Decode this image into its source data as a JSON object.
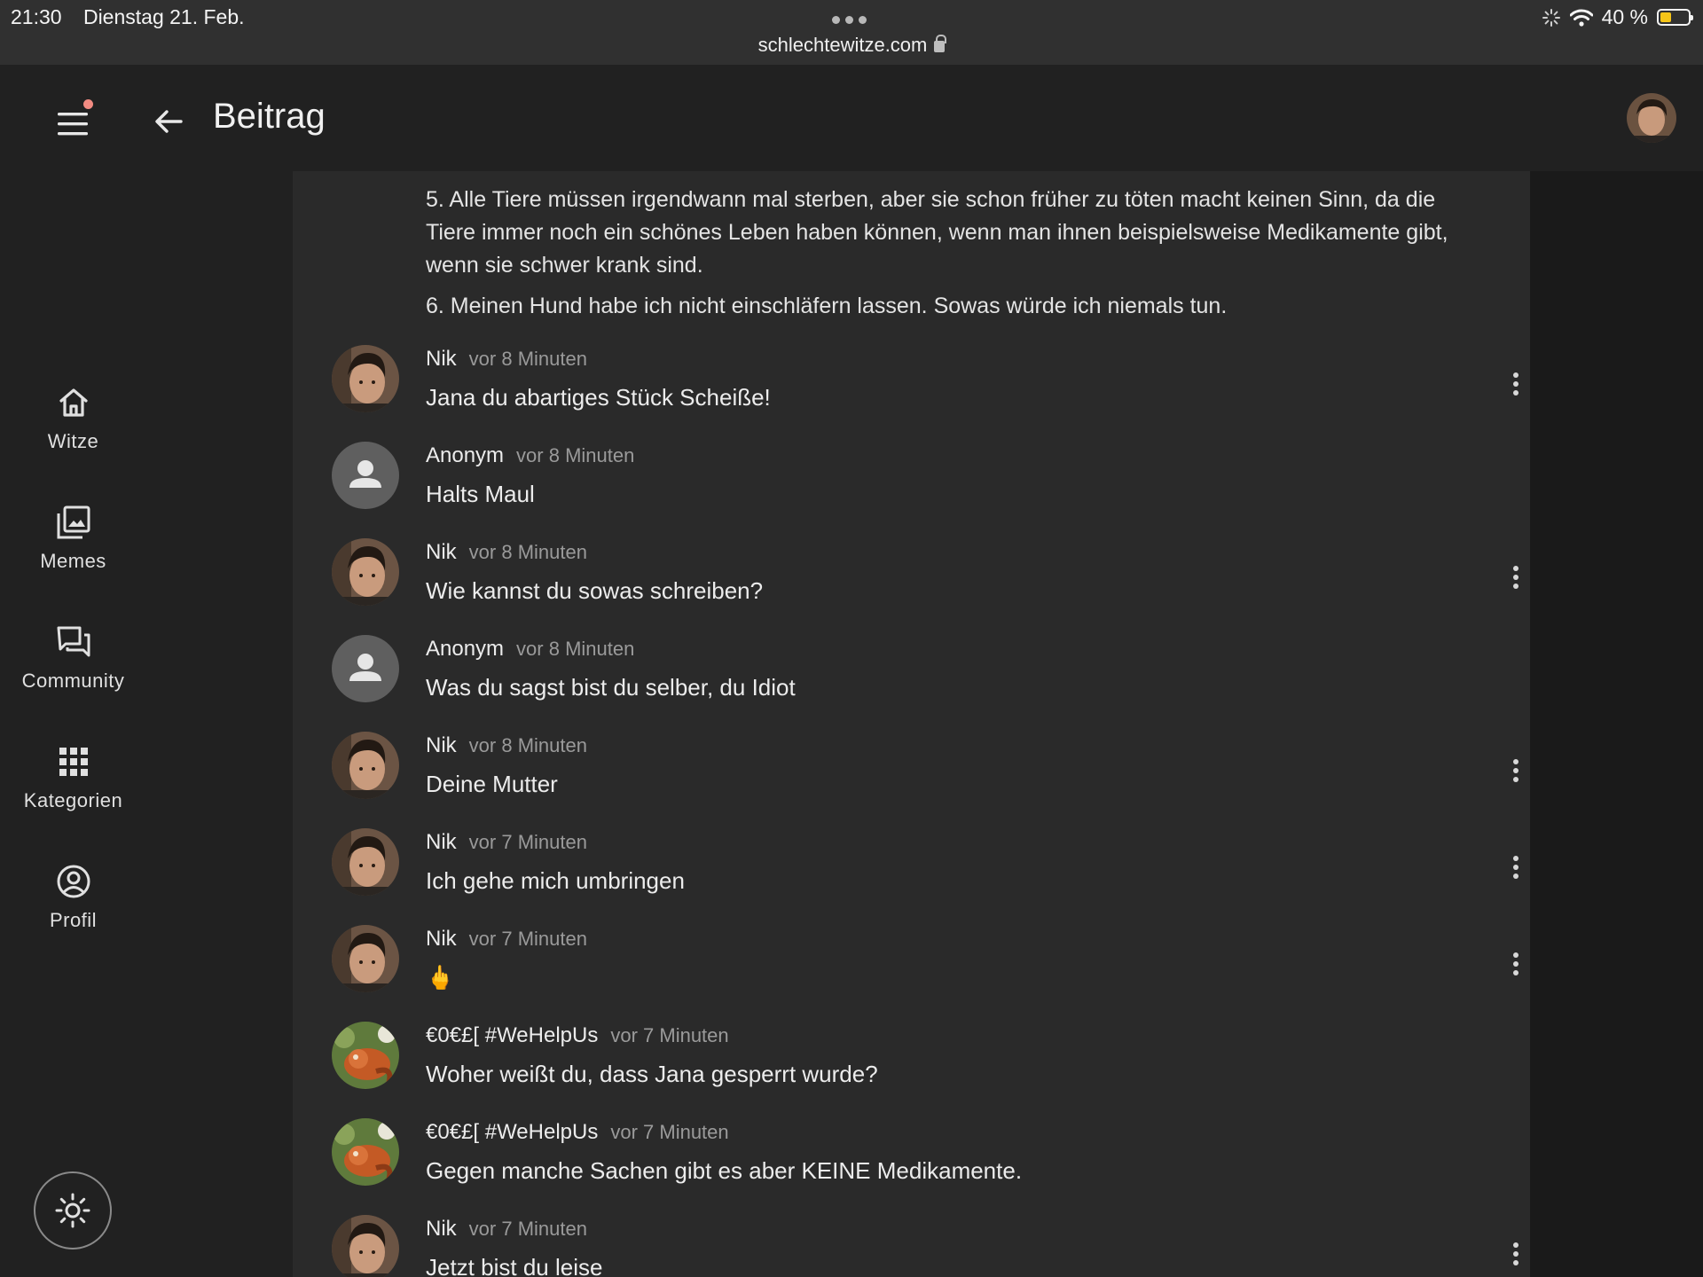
{
  "status": {
    "time": "21:30",
    "date": "Dienstag 21. Feb.",
    "url": "schlechtewitze.com",
    "battery_text": "40 %",
    "battery_level": 0.4,
    "battery_color": "#f5c518"
  },
  "header": {
    "title": "Beitrag",
    "menu_icon": "hamburger-menu-icon",
    "back_icon": "arrow-left-icon",
    "notification_dot_color": "#f28b82"
  },
  "sidebar": {
    "items": [
      {
        "label": "Witze",
        "icon": "home-icon"
      },
      {
        "label": "Memes",
        "icon": "photo-library-icon"
      },
      {
        "label": "Community",
        "icon": "forum-icon"
      },
      {
        "label": "Kategorien",
        "icon": "apps-grid-icon"
      },
      {
        "label": "Profil",
        "icon": "account-circle-icon"
      }
    ],
    "theme_icon": "sun-icon"
  },
  "post": {
    "points": [
      "5. Alle Tiere müssen irgendwann mal sterben, aber sie schon früher zu töten macht keinen Sinn, da die Tiere immer noch ein schönes Leben haben können, wenn man ihnen beispielsweise Medikamente gibt, wenn sie schwer krank sind.",
      "6. Meinen Hund habe ich nicht einschläfern lassen. Sowas würde ich niemals tun."
    ]
  },
  "comments": [
    {
      "author": "Nik",
      "time": "vor 8 Minuten",
      "text": "Jana du abartiges Stück Scheiße!"
    },
    {
      "author": "Anonym",
      "time": "vor 8 Minuten",
      "text": "Halts Maul"
    },
    {
      "author": "Nik",
      "time": "vor 8 Minuten",
      "text": "Wie kannst du sowas schreiben?"
    },
    {
      "author": "Anonym",
      "time": "vor 8 Minuten",
      "text": "Was du sagst bist du selber, du Idiot"
    },
    {
      "author": "Nik",
      "time": "vor 8 Minuten",
      "text": "Deine Mutter"
    },
    {
      "author": "Nik",
      "time": "vor 7 Minuten",
      "text": "Ich gehe mich umbringen"
    },
    {
      "author": "Nik",
      "time": "vor 7 Minuten",
      "text": "🖕"
    },
    {
      "author": "€0€£[ #WeHelpUs",
      "time": "vor 7 Minuten",
      "text": "Woher weißt du, dass Jana gesperrt wurde?"
    },
    {
      "author": "€0€£[ #WeHelpUs",
      "time": "vor 7 Minuten",
      "text": "Gegen manche Sachen gibt es aber KEINE Medikamente."
    },
    {
      "author": "Nik",
      "time": "vor 7 Minuten",
      "text": "Jetzt bist du leise"
    }
  ]
}
